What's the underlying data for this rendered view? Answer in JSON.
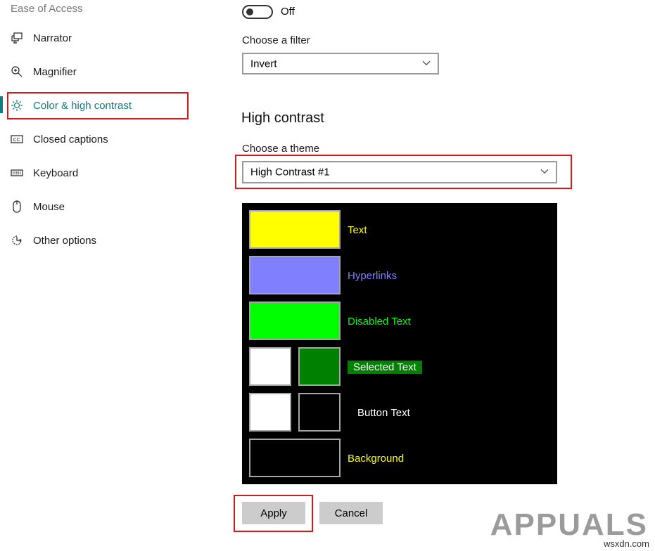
{
  "sidebar": {
    "section_title": "Ease of Access",
    "items": [
      {
        "label": "Narrator",
        "icon": "narrator-icon",
        "active": false
      },
      {
        "label": "Magnifier",
        "icon": "magnifier-icon",
        "active": false
      },
      {
        "label": "Color & high contrast",
        "icon": "brightness-icon",
        "active": true
      },
      {
        "label": "Closed captions",
        "icon": "closed-captions-icon",
        "active": false
      },
      {
        "label": "Keyboard",
        "icon": "keyboard-icon",
        "active": false
      },
      {
        "label": "Mouse",
        "icon": "mouse-icon",
        "active": false
      },
      {
        "label": "Other options",
        "icon": "other-options-icon",
        "active": false
      }
    ],
    "accent_color": "#137a7f"
  },
  "color_filters": {
    "toggle_state": "Off",
    "filter_label": "Choose a filter",
    "filter_value": "Invert"
  },
  "high_contrast": {
    "heading": "High contrast",
    "theme_label": "Choose a theme",
    "theme_value": "High Contrast #1",
    "preview": {
      "background": "#000000",
      "rows": [
        {
          "label": "Text",
          "label_color": "#ffff00",
          "swatches": [
            "#ffff00"
          ]
        },
        {
          "label": "Hyperlinks",
          "label_color": "#8080ff",
          "swatches": [
            "#8080ff"
          ]
        },
        {
          "label": "Disabled Text",
          "label_color": "#00ff00",
          "swatches": [
            "#00ff00"
          ]
        },
        {
          "label": "Selected Text",
          "label_color": "#ffffff",
          "label_bg": "#008000",
          "swatches": [
            "#ffffff",
            "#008000"
          ]
        },
        {
          "label": "Button Text",
          "label_color": "#ffffff",
          "swatches": [
            "#ffffff",
            "#000000"
          ]
        },
        {
          "label": "Background",
          "label_color": "#ffff00",
          "swatches": [
            "#000000"
          ]
        }
      ]
    },
    "apply_label": "Apply",
    "cancel_label": "Cancel"
  },
  "watermark": {
    "logo_text": "APPUALS",
    "site": "wsxdn.com"
  },
  "highlight_color": "#d01b1b"
}
